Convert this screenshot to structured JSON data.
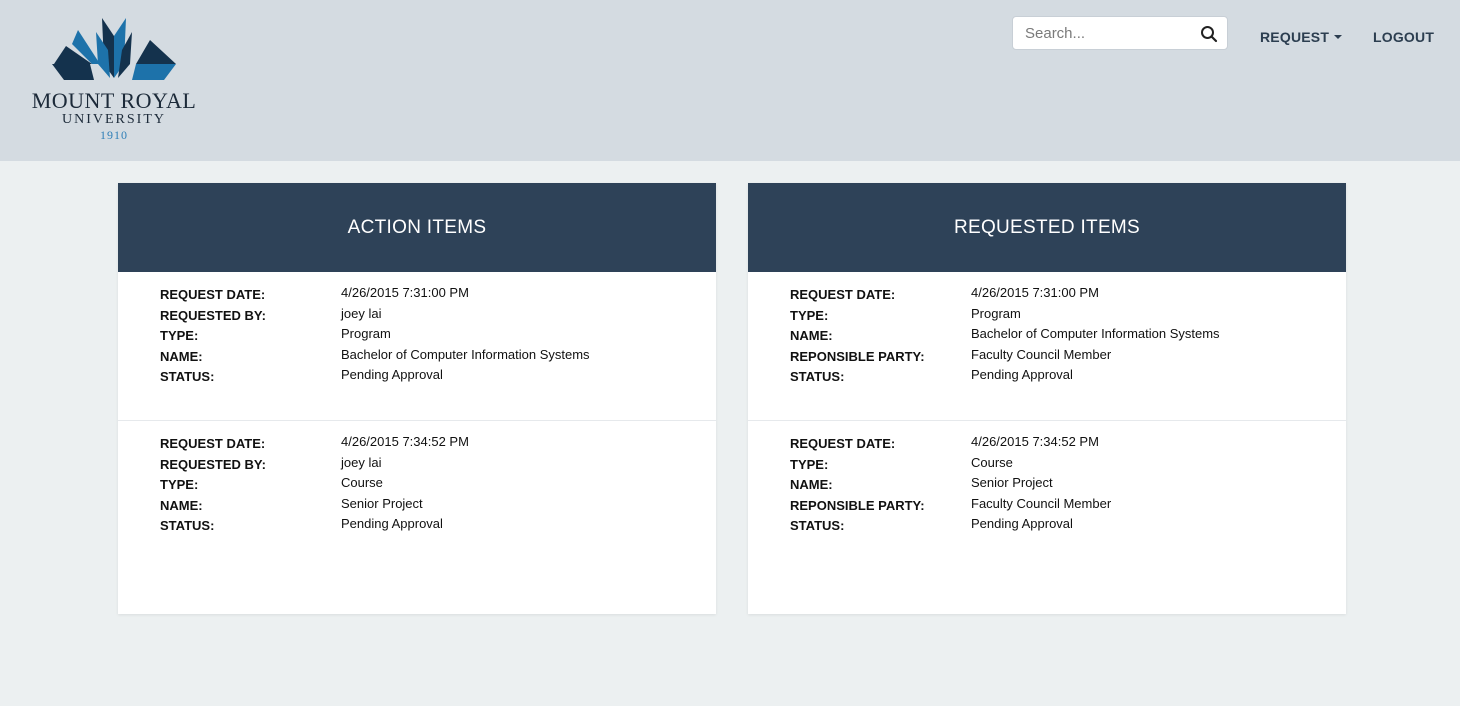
{
  "logo": {
    "line1": "MOUNT ROYAL",
    "line2": "UNIVERSITY",
    "line3": "1910",
    "colors": {
      "dark": "#14324d",
      "blue": "#1d72aa"
    }
  },
  "search": {
    "placeholder": "Search..."
  },
  "nav": {
    "request": "REQUEST",
    "logout": "LOGOUT"
  },
  "action_items": {
    "title": "ACTION ITEMS",
    "items": [
      {
        "rows": [
          {
            "label": "REQUEST DATE:",
            "value": "4/26/2015 7:31:00 PM"
          },
          {
            "label": "REQUESTED BY:",
            "value": "joey lai"
          },
          {
            "label": "TYPE:",
            "value": "Program"
          },
          {
            "label": "NAME:",
            "value": "Bachelor of Computer Information Systems"
          },
          {
            "label": "STATUS:",
            "value": "Pending Approval"
          }
        ]
      },
      {
        "rows": [
          {
            "label": "REQUEST DATE:",
            "value": "4/26/2015 7:34:52 PM"
          },
          {
            "label": "REQUESTED BY:",
            "value": "joey lai"
          },
          {
            "label": "TYPE:",
            "value": "Course"
          },
          {
            "label": "NAME:",
            "value": "Senior Project"
          },
          {
            "label": "STATUS:",
            "value": "Pending Approval"
          }
        ]
      }
    ]
  },
  "requested_items": {
    "title": "REQUESTED ITEMS",
    "items": [
      {
        "rows": [
          {
            "label": "REQUEST DATE:",
            "value": "4/26/2015 7:31:00 PM"
          },
          {
            "label": "TYPE:",
            "value": "Program"
          },
          {
            "label": "NAME:",
            "value": "Bachelor of Computer Information Systems"
          },
          {
            "label": "REPONSIBLE PARTY:",
            "value": "Faculty Council Member"
          },
          {
            "label": "STATUS:",
            "value": "Pending Approval"
          }
        ]
      },
      {
        "rows": [
          {
            "label": "REQUEST DATE:",
            "value": "4/26/2015 7:34:52 PM"
          },
          {
            "label": "TYPE:",
            "value": "Course"
          },
          {
            "label": "NAME:",
            "value": "Senior Project"
          },
          {
            "label": "REPONSIBLE PARTY:",
            "value": "Faculty Council Member"
          },
          {
            "label": "STATUS:",
            "value": "Pending Approval"
          }
        ]
      }
    ]
  },
  "colors": {
    "header_bg": "#d4dbe1",
    "page_bg": "#ecf0f1",
    "panel_header_bg": "#2e4258",
    "nav_text": "#2c3e50"
  }
}
